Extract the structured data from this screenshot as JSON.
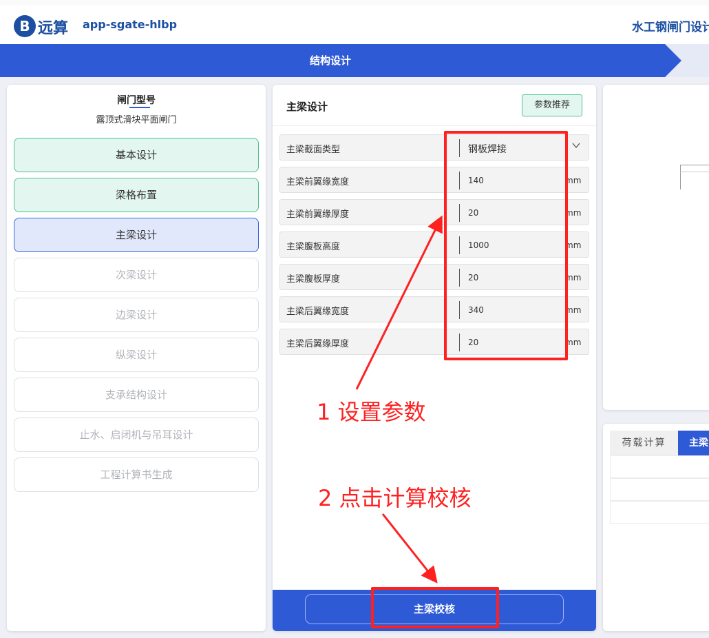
{
  "header": {
    "logo_letter": "B",
    "logo_text": "远算",
    "app_name": "app-sgate-hlbp",
    "system_title": "水工钢闸门设计"
  },
  "stepbar": {
    "active_step": "结构设计"
  },
  "left_panel": {
    "gate_type_title": "闸门型号",
    "gate_type_value": "露顶式滑块平面闸门",
    "nav_items": [
      {
        "label": "基本设计",
        "state": "done"
      },
      {
        "label": "梁格布置",
        "state": "done"
      },
      {
        "label": "主梁设计",
        "state": "current"
      },
      {
        "label": "次梁设计",
        "state": "pending"
      },
      {
        "label": "边梁设计",
        "state": "pending"
      },
      {
        "label": "纵梁设计",
        "state": "pending"
      },
      {
        "label": "支承结构设计",
        "state": "pending"
      },
      {
        "label": "止水、启闭机与吊耳设计",
        "state": "pending"
      },
      {
        "label": "工程计算书生成",
        "state": "pending"
      }
    ]
  },
  "main_panel": {
    "title": "主梁设计",
    "recommend_button": "参数推荐",
    "fields": [
      {
        "label": "主梁截面类型",
        "value": "钢板焊接",
        "type": "select"
      },
      {
        "label": "主梁前翼缘宽度",
        "value": "140",
        "unit": "mm"
      },
      {
        "label": "主梁前翼缘厚度",
        "value": "20",
        "unit": "mm"
      },
      {
        "label": "主梁腹板高度",
        "value": "1000",
        "unit": "mm"
      },
      {
        "label": "主梁腹板厚度",
        "value": "20",
        "unit": "mm"
      },
      {
        "label": "主梁后翼缘宽度",
        "value": "340",
        "unit": "mm"
      },
      {
        "label": "主梁后翼缘厚度",
        "value": "20",
        "unit": "mm"
      }
    ],
    "check_button": "主梁校核"
  },
  "right_panel": {
    "tabs": [
      "荷载计算",
      "主梁"
    ]
  },
  "annotations": {
    "step1": "1 设置参数",
    "step2": "2 点击计算校核",
    "color": "#ff2020"
  },
  "colors": {
    "primary": "#2e5ad6",
    "brand": "#1c4fa1",
    "done_bg": "#e3f6ef",
    "done_border": "#4fc08d",
    "current_bg": "#e2e8fb"
  }
}
